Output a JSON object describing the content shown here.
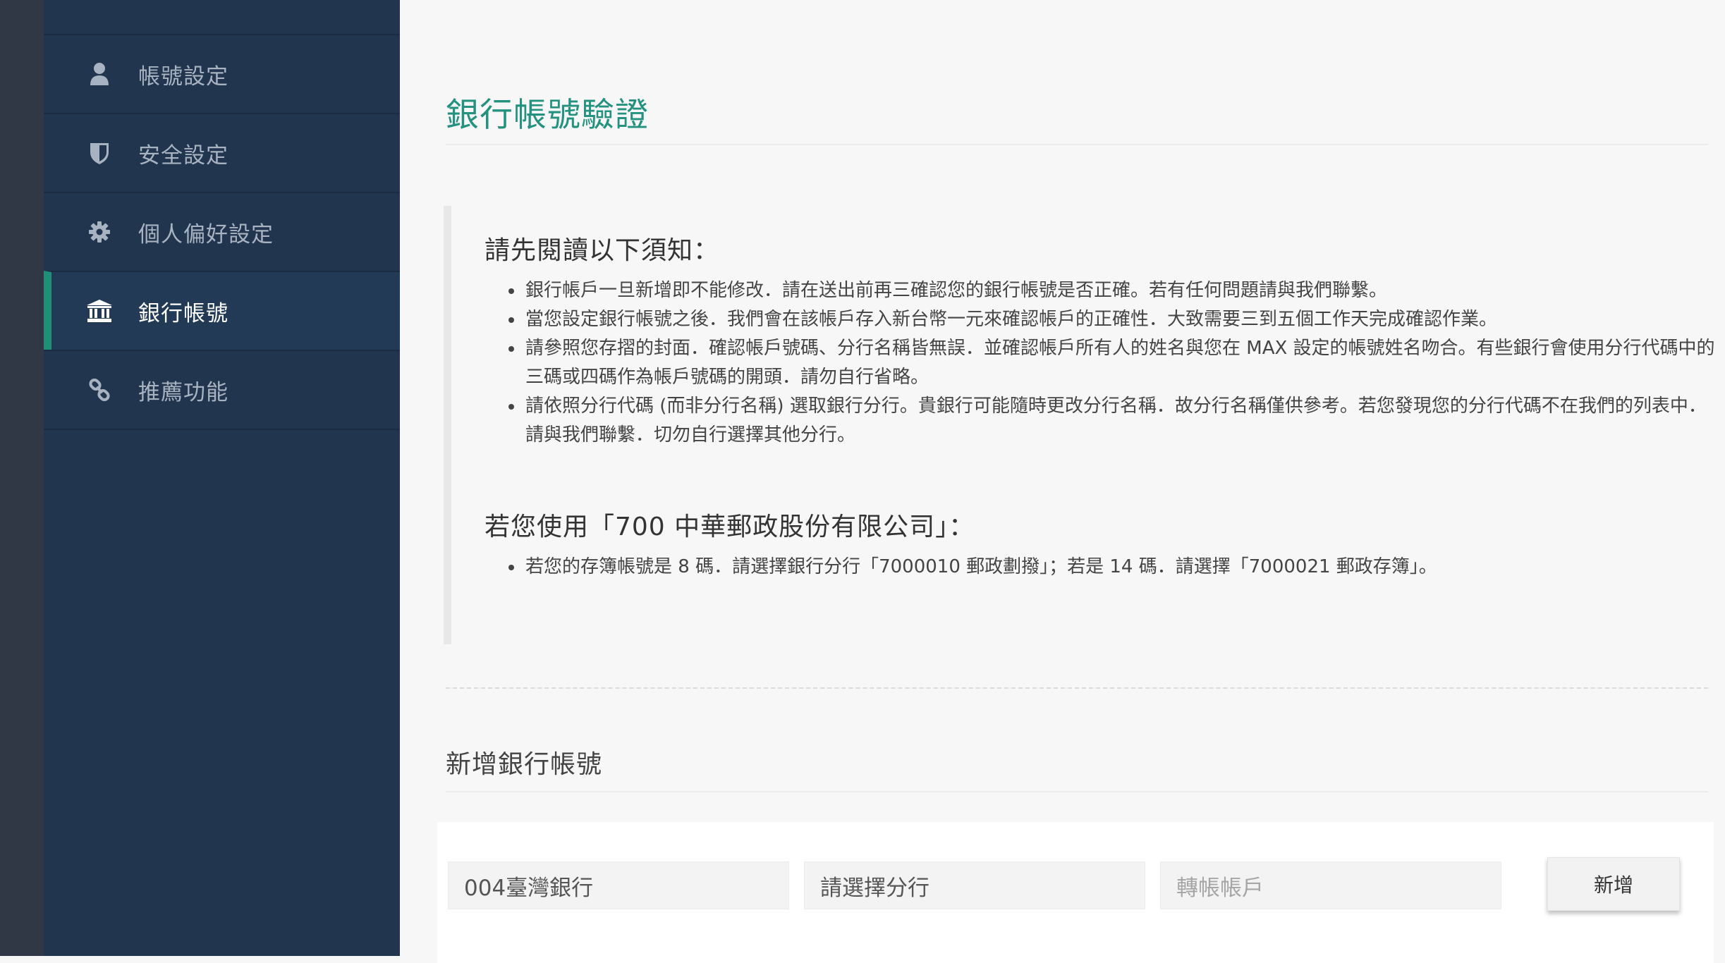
{
  "sidebar": {
    "items": [
      {
        "label": "帳號設定",
        "icon": "user-icon",
        "active": false
      },
      {
        "label": "安全設定",
        "icon": "shield-icon",
        "active": false
      },
      {
        "label": "個人偏好設定",
        "icon": "gear-icon",
        "active": false
      },
      {
        "label": "銀行帳號",
        "icon": "bank-icon",
        "active": true
      },
      {
        "label": "推薦功能",
        "icon": "link-icon",
        "active": false
      }
    ]
  },
  "page": {
    "title": "銀行帳號驗證"
  },
  "notice": {
    "heading": "請先閱讀以下須知：",
    "items": [
      "銀行帳戶一旦新增即不能修改．請在送出前再三確認您的銀行帳號是否正確。若有任何問題請與我們聯繫。",
      "當您設定銀行帳號之後．我們會在該帳戶存入新台幣一元來確認帳戶的正確性．大致需要三到五個工作天完成確認作業。",
      "請參照您存摺的封面．確認帳戶號碼、分行名稱皆無誤．並確認帳戶所有人的姓名與您在 MAX 設定的帳號姓名吻合。有些銀行會使用分行代碼中的三碼或四碼作為帳戶號碼的開頭．請勿自行省略。",
      "請依照分行代碼 (而非分行名稱) 選取銀行分行。貴銀行可能隨時更改分行名稱．故分行名稱僅供參考。若您發現您的分行代碼不在我們的列表中．請與我們聯繫．切勿自行選擇其他分行。"
    ],
    "post_heading": "若您使用「700 中華郵政股份有限公司」：",
    "post_items": [
      "若您的存簿帳號是 8 碼．請選擇銀行分行「7000010 郵政劃撥」；若是 14 碼．請選擇「7000021 郵政存簿」。"
    ]
  },
  "add_section": {
    "title": "新增銀行帳號",
    "bank_value": "004臺灣銀行",
    "branch_value": "請選擇分行",
    "account_placeholder": "轉帳帳戶",
    "add_button": "新增"
  },
  "colors": {
    "sidebar": "#22354e",
    "active_accent": "#1f8f78",
    "title": "#24927e"
  }
}
